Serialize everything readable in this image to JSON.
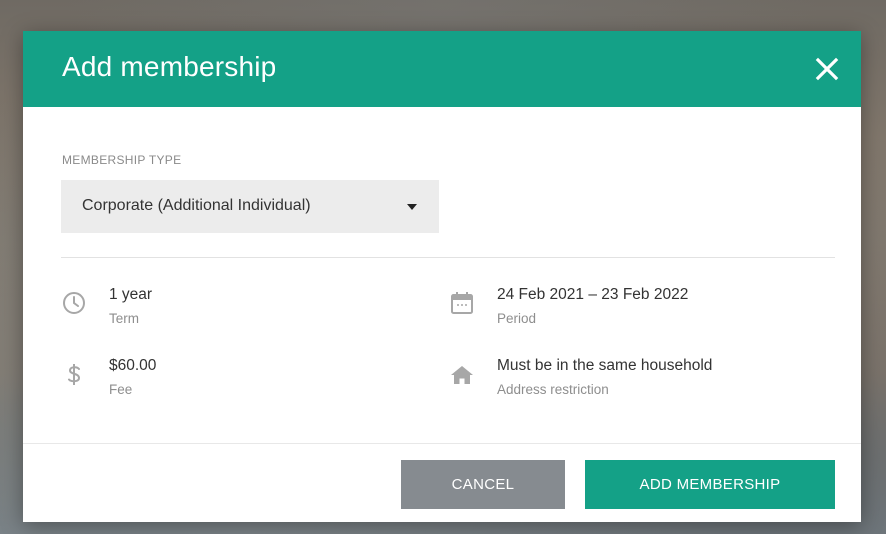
{
  "modal": {
    "title": "Add membership",
    "close_icon": "close-icon"
  },
  "membership_type": {
    "label": "MEMBERSHIP TYPE",
    "selected": "Corporate (Additional Individual)"
  },
  "details": [
    {
      "icon": "clock-icon",
      "value": "1 year",
      "label": "Term"
    },
    {
      "icon": "calendar-icon",
      "value": "24 Feb 2021 – 23 Feb 2022",
      "label": "Period"
    },
    {
      "icon": "dollar-icon",
      "value": "$60.00",
      "label": "Fee"
    },
    {
      "icon": "home-icon",
      "value": "Must be in the same household",
      "label": "Address restriction"
    }
  ],
  "actions": {
    "cancel_label": "CANCEL",
    "add_label": "ADD MEMBERSHIP"
  },
  "colors": {
    "primary": "#14a187",
    "secondary_button": "#868b90",
    "icon": "#a7a7a7"
  }
}
